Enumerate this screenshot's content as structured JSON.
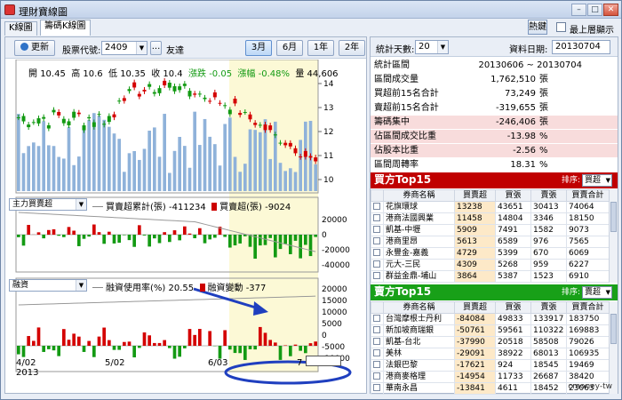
{
  "window": {
    "title": "理財寶線圖",
    "right_button": "熱鍵",
    "top_label": "最上層顯示"
  },
  "tabs": [
    "K線圖",
    "籌碼K線圖"
  ],
  "toolbar": {
    "refresh": "更新",
    "stock_label": "股票代號:",
    "stock_code": "2409",
    "stock_name": "友達",
    "ellipsis": "...",
    "periods": [
      "3月",
      "6月",
      "1年",
      "2年"
    ],
    "active_period": "3月"
  },
  "quote": {
    "open_label": "開",
    "open": "10.45",
    "high_label": "高",
    "high": "10.6",
    "low_label": "低",
    "low": "10.35",
    "close_label": "收",
    "close": "10.4",
    "change_label": "漲跌",
    "change": "-0.05",
    "pct_label": "漲幅",
    "pct": "-0.48%",
    "vol_label": "量",
    "vol": "44,606"
  },
  "price_axis": [
    "14",
    "13",
    "12",
    "11",
    "10"
  ],
  "mid": {
    "select": "主力買賣超",
    "cum_label": "買賣超累計(張)",
    "cum_value": "-411234",
    "day_label": "買賣超(張)",
    "day_value": "-9024",
    "axis": [
      "20000",
      "0",
      "-20000",
      "-40000"
    ]
  },
  "low": {
    "select": "融資",
    "rate_label": "融資使用率(%)",
    "rate_value": "20.55",
    "chg_label": "融資變動",
    "chg_value": "-377",
    "axis": [
      "20000",
      "15000",
      "10000",
      "5000",
      "0",
      "-5000",
      "-10000"
    ]
  },
  "dates": [
    "4/02",
    "5/02",
    "6/03",
    "7"
  ],
  "year": "2013",
  "stats": {
    "days_label": "統計天數:",
    "days": "20",
    "date_label": "資料日期:",
    "date": "20130704",
    "rows": [
      {
        "k": "統計區間",
        "v": "20130606 ~ 20130704",
        "u": ""
      },
      {
        "k": "區間成交量",
        "v": "1,762,510",
        "u": "張"
      },
      {
        "k": "買超前15名合計",
        "v": "73,249",
        "u": "張"
      },
      {
        "k": "賣超前15名合計",
        "v": "-319,655",
        "u": "張"
      },
      {
        "k": "籌碼集中",
        "v": "-246,406",
        "u": "張"
      },
      {
        "k": "佔區間成交比重",
        "v": "-13.98",
        "u": "%"
      },
      {
        "k": "佔股本比重",
        "v": "-2.56",
        "u": "%"
      },
      {
        "k": "區間周轉率",
        "v": "18.31",
        "u": "%"
      }
    ]
  },
  "buy_top": {
    "title": "買方Top15",
    "sort_label": "排序:",
    "sort": "買超",
    "headers": [
      "券商名稱",
      "買賣超",
      "買張",
      "賣張",
      "買賣合計"
    ],
    "rows": [
      [
        "花旗環球",
        "13238",
        "43651",
        "30413",
        "74064"
      ],
      [
        "港商法國興業",
        "11458",
        "14804",
        "3346",
        "18150"
      ],
      [
        "凱基-中壢",
        "5909",
        "7491",
        "1582",
        "9073"
      ],
      [
        "港商里昂",
        "5613",
        "6589",
        "976",
        "7565"
      ],
      [
        "永豐金-嘉義",
        "4729",
        "5399",
        "670",
        "6069"
      ],
      [
        "元大-三民",
        "4309",
        "5268",
        "959",
        "6227"
      ],
      [
        "群益金鼎-埔山",
        "3864",
        "5387",
        "1523",
        "6910"
      ]
    ]
  },
  "sell_top": {
    "title": "賣方Top15",
    "sort_label": "排序:",
    "sort": "賣超",
    "headers": [
      "券商名稱",
      "買賣超",
      "買張",
      "賣張",
      "買賣合計"
    ],
    "rows": [
      [
        "台灣摩根士丹利",
        "-84084",
        "49833",
        "133917",
        "183750"
      ],
      [
        "新加坡商瑞銀",
        "-50761",
        "59561",
        "110322",
        "169883"
      ],
      [
        "凱基-台北",
        "-37990",
        "20518",
        "58508",
        "79026"
      ],
      [
        "美林",
        "-29091",
        "38922",
        "68013",
        "106935"
      ],
      [
        "法銀巴黎",
        "-17621",
        "924",
        "18545",
        "19469"
      ],
      [
        "港商麥格理",
        "-14954",
        "11733",
        "26687",
        "38420"
      ],
      [
        "華南永昌",
        "-13841",
        "4611",
        "18452",
        "23063"
      ]
    ]
  },
  "watermark": "cmoney-tw",
  "colors": {
    "up": "#d40000",
    "down": "#139a13",
    "buy_head": "#c00000",
    "sell_head": "#18a018",
    "highlight": "#fcf9d6"
  }
}
